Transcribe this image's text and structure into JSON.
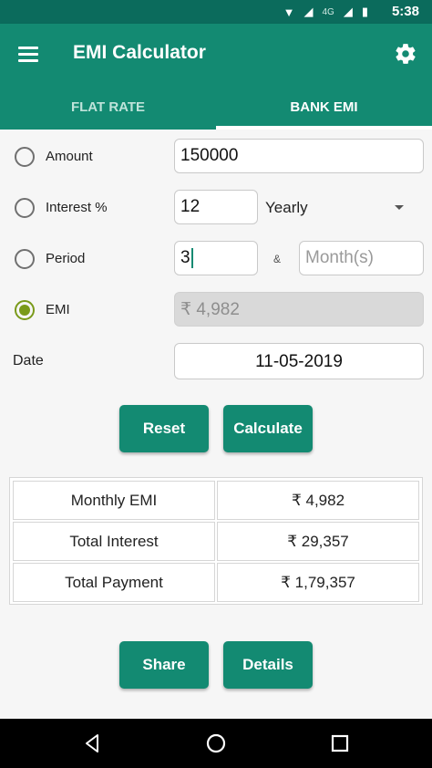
{
  "status_bar": {
    "time": "5:38",
    "network": "4G"
  },
  "app_bar": {
    "title": "EMI Calculator"
  },
  "tabs": [
    {
      "label": "FLAT RATE",
      "active": false
    },
    {
      "label": "BANK EMI",
      "active": true
    }
  ],
  "form": {
    "amount": {
      "label": "Amount",
      "value": "150000",
      "selected": false
    },
    "interest": {
      "label": "Interest %",
      "value": "12",
      "period_type": "Yearly",
      "selected": false
    },
    "period": {
      "label": "Period",
      "value": "3",
      "separator": "&",
      "months_placeholder": "Month(s)",
      "selected": false
    },
    "emi": {
      "label": "EMI",
      "value": "₹ 4,982",
      "selected": true
    },
    "date": {
      "label": "Date",
      "value": "11-05-2019"
    }
  },
  "buttons": {
    "reset": "Reset",
    "calculate": "Calculate",
    "share": "Share",
    "details": "Details"
  },
  "results": [
    {
      "label": "Monthly EMI",
      "value": "₹ 4,982"
    },
    {
      "label": "Total Interest",
      "value": "₹ 29,357"
    },
    {
      "label": "Total Payment",
      "value": "₹ 1,79,357"
    }
  ],
  "colors": {
    "primary": "#138a72",
    "status_bar": "#0b6b5c",
    "radio_checked": "#7a9a1a"
  }
}
